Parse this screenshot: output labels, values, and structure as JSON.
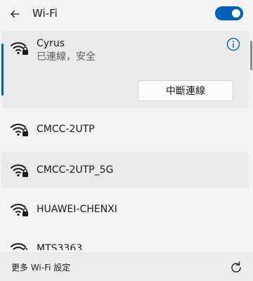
{
  "header": {
    "title": "Wi-Fi",
    "back_icon": "arrow-left-icon",
    "toggle_on": true
  },
  "connected_network": {
    "name": "Cyrus",
    "status": "已連線，安全",
    "disconnect_label": "中斷連線",
    "icon": "wifi-secured-icon",
    "info_icon": "info-icon"
  },
  "networks": [
    {
      "name": "CMCC-2UTP",
      "icon": "wifi-secured-icon"
    },
    {
      "name": "CMCC-2UTP_5G",
      "icon": "wifi-secured-icon"
    },
    {
      "name": "HUAWEI-CHENXI",
      "icon": "wifi-secured-icon"
    },
    {
      "name": "MTS3363",
      "icon": "wifi-secured-icon"
    }
  ],
  "footer": {
    "more_settings_label": "更多 Wi-Fi 設定",
    "refresh_icon": "refresh-icon"
  },
  "colors": {
    "accent": "#005fb8",
    "background": "#f3f3f3",
    "hover": "#e9e9e9"
  }
}
